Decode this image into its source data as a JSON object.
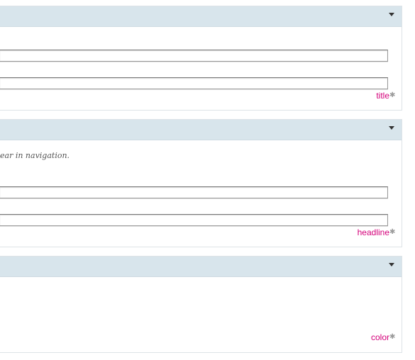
{
  "panels": [
    {
      "tag": "title",
      "icon": "gear-icon"
    },
    {
      "hint": "ear in navigation.",
      "tag": "headline",
      "icon": "gear-icon"
    },
    {
      "tag": "color",
      "icon": "gear-icon"
    }
  ]
}
